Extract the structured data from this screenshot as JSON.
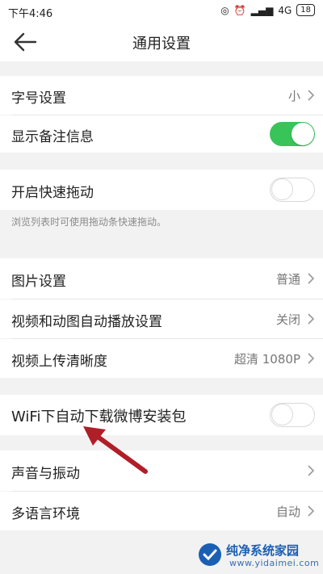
{
  "status_bar": {
    "time": "下午4:46",
    "network": "4G",
    "battery": "18"
  },
  "header": {
    "title": "通用设置"
  },
  "settings": {
    "font_size": {
      "label": "字号设置",
      "value": "小"
    },
    "show_remarks": {
      "label": "显示备注信息",
      "toggle": "on"
    },
    "fast_scroll": {
      "label": "开启快速拖动",
      "toggle": "off",
      "hint": "浏览列表时可使用拖动条快速拖动。"
    },
    "image_settings": {
      "label": "图片设置",
      "value": "普通"
    },
    "autoplay": {
      "label": "视频和动图自动播放设置",
      "value": "关闭"
    },
    "upload_quality": {
      "label": "视频上传清晰度",
      "value": "超清 1080P"
    },
    "wifi_download": {
      "label": "WiFi下自动下载微博安装包",
      "toggle": "off"
    },
    "sound_vibration": {
      "label": "声音与振动"
    },
    "language": {
      "label": "多语言环境",
      "value": "自动"
    }
  },
  "watermark": {
    "name": "纯净系统家园",
    "url": "www.yidaimei.com"
  },
  "colors": {
    "toggle_on": "#39c45a",
    "arrow": "#b01e28",
    "watermark": "#1a5fb4"
  }
}
